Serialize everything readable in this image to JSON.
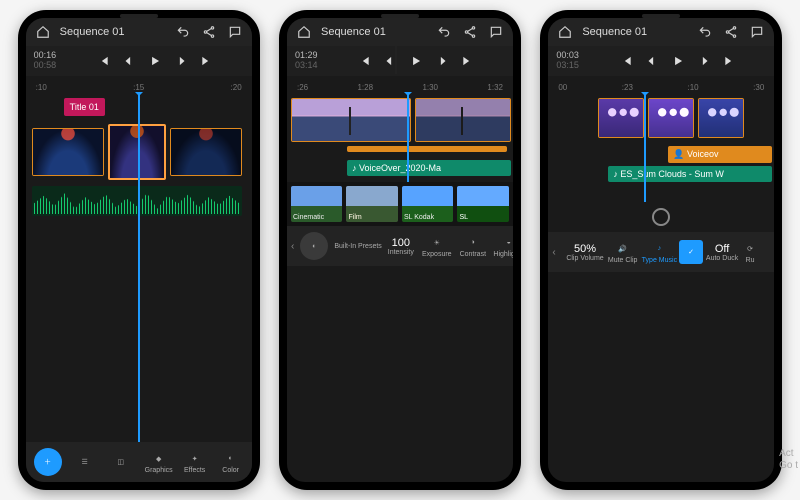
{
  "watermark": {
    "line1": "Act",
    "line2": "Go t"
  },
  "phones": [
    {
      "title": "Sequence 01",
      "timecode": "00:16",
      "altTimecode": "00:58",
      "ruler": [
        ":10",
        ":15",
        ":20"
      ],
      "titleClip": "Title 01",
      "bottom": [
        {
          "name": "add",
          "label": ""
        },
        {
          "name": "edit",
          "label": ""
        },
        {
          "name": "crop",
          "label": ""
        },
        {
          "name": "graphics",
          "label": "Graphics"
        },
        {
          "name": "effects",
          "label": "Effects"
        },
        {
          "name": "color",
          "label": "Color"
        }
      ]
    },
    {
      "title": "Sequence 01",
      "timecode": "01:29",
      "altTimecode": "03:14",
      "ruler": [
        ":26",
        "1:28",
        "1:30",
        "1:32"
      ],
      "voiceover": "VoiceOver_2020-Ma",
      "presets": [
        {
          "name": "cinematic",
          "label": "Cinematic"
        },
        {
          "name": "film",
          "label": "Film"
        },
        {
          "name": "sl-kodak",
          "label": "SL Kodak"
        },
        {
          "name": "sl",
          "label": "SL"
        }
      ],
      "bottom": {
        "builtin": "Built-In Presets",
        "intensity_val": "100",
        "intensity": "Intensity",
        "exposure": "Exposure",
        "contrast": "Contrast",
        "highlights": "Highlights"
      }
    },
    {
      "title": "Sequence 01",
      "timecode": "00:03",
      "altTimecode": "03:15",
      "ruler": [
        "00",
        ":23",
        ":10",
        ":30"
      ],
      "voiceover": "Voiceov",
      "music": "ES_Sum Clouds - Sum W",
      "bottom": {
        "clipvol_val": "50%",
        "clipvol": "Clip Volume",
        "mute": "Mute Clip",
        "type": "Type Music",
        "autoduck_val": "Off",
        "autoduck": "Auto Duck",
        "last": "Ru"
      }
    }
  ],
  "transport": [
    "skip-start",
    "step-back",
    "play",
    "step-fwd",
    "skip-end"
  ]
}
